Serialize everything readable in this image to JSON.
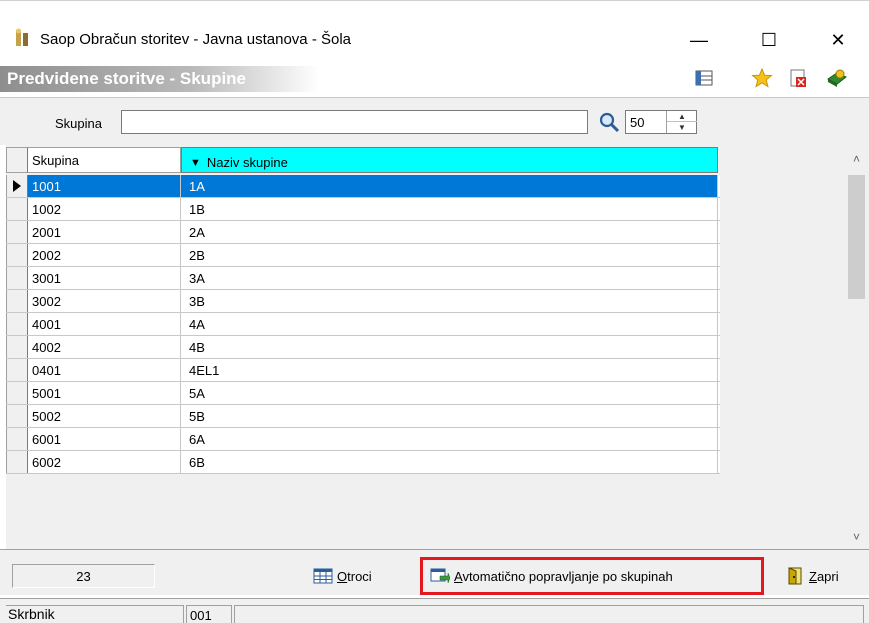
{
  "window": {
    "title": "Saop  Obračun storitev - Javna ustanova - Šola",
    "minimize_glyph": "—",
    "maximize_glyph": "☐",
    "close_glyph": "✕"
  },
  "form": {
    "title": "Predvidene storitve - Skupine",
    "toolbar_icons": [
      "grid-settings-icon",
      "favorite-star-icon",
      "close-form-icon",
      "help-book-icon"
    ]
  },
  "filter": {
    "label": "Skupina",
    "value": "",
    "page_size": "50",
    "spin_up": "▲",
    "spin_down": "▼"
  },
  "grid": {
    "columns": [
      "Skupina",
      "Naziv skupine"
    ],
    "sort_glyph": "▼",
    "rows": [
      {
        "skupina": "1001",
        "naziv": "1A"
      },
      {
        "skupina": "1002",
        "naziv": "1B"
      },
      {
        "skupina": "2001",
        "naziv": "2A"
      },
      {
        "skupina": "2002",
        "naziv": "2B"
      },
      {
        "skupina": "3001",
        "naziv": "3A"
      },
      {
        "skupina": "3002",
        "naziv": "3B"
      },
      {
        "skupina": "4001",
        "naziv": "4A"
      },
      {
        "skupina": "4002",
        "naziv": "4B"
      },
      {
        "skupina": "0401",
        "naziv": "4EL1"
      },
      {
        "skupina": "5001",
        "naziv": "5A"
      },
      {
        "skupina": "5002",
        "naziv": "5B"
      },
      {
        "skupina": "6001",
        "naziv": "6A"
      },
      {
        "skupina": "6002",
        "naziv": "6B"
      }
    ],
    "selected_index": 0,
    "scroll_up": "˄",
    "scroll_down": "˅"
  },
  "bottom": {
    "count": "23",
    "otroci_underlined": "O",
    "otroci_rest": "troci",
    "avto_underlined": "A",
    "avto_rest": "vtomatično popravljanje po skupinah",
    "zapri_underlined": "Z",
    "zapri_rest": "apri"
  },
  "status": {
    "label": "Skrbnik",
    "code": "001"
  },
  "colors": {
    "header_highlight": "#00ffff",
    "selection": "#0078d7",
    "annotation_red": "#e4161e"
  }
}
